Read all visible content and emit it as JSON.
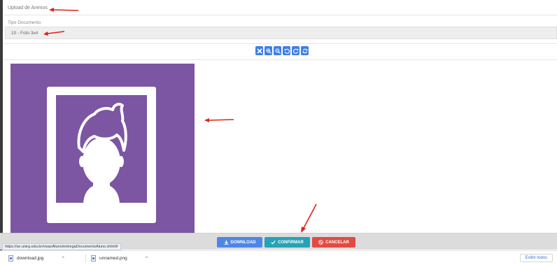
{
  "section": {
    "title": "Upload de Anexos"
  },
  "document_type": {
    "label": "Tipo Documento",
    "value": "10 - Foto 3x4"
  },
  "toolbar": {
    "icons": [
      "close-icon",
      "zoom-in-icon",
      "zoom-out-icon",
      "rotate-left-icon",
      "rotate-right-icon",
      "reset-icon"
    ]
  },
  "preview": {
    "image": "profile-avatar-placeholder",
    "background": "#7c56a3"
  },
  "actions": {
    "download_label": "DOWNLOAD",
    "confirm_label": "CONFIRMAR",
    "cancel_label": "CANCELAR"
  },
  "status_bar": {
    "url": "https://se.unirg.edu.br/visaoAluno/entregaDocumentoAluno.xhtml#"
  },
  "downloads": {
    "items": [
      {
        "name": "download.jpg"
      },
      {
        "name": "unnamed.png"
      }
    ],
    "show_all_label": "Exibir todos"
  },
  "colors": {
    "download": "#4d86e6",
    "confirm": "#27a3b5",
    "cancel": "#e04b43",
    "annotation_arrow": "#e0201c"
  }
}
